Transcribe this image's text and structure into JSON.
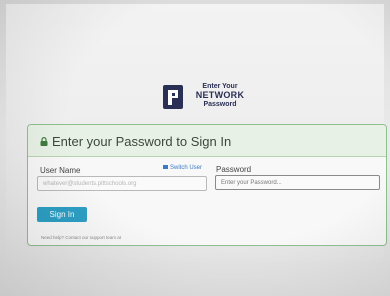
{
  "logo": {
    "line1": "Enter Your",
    "line2": "NETWORK",
    "line3": "Password"
  },
  "login": {
    "title": "Enter your Password to Sign In",
    "username_label": "User Name",
    "username_value": "whatever@students.pittschools.org",
    "switch_user_label": "Switch User",
    "password_label": "Password",
    "password_placeholder": "Enter your Password...",
    "sign_in_label": "Sign In",
    "help_text": "Need help? Contact our support team at"
  },
  "colors": {
    "accent_button": "#2d9fc4",
    "card_border": "#8fbf8f",
    "logo": "#2a2f55",
    "link": "#3b7ac9"
  }
}
